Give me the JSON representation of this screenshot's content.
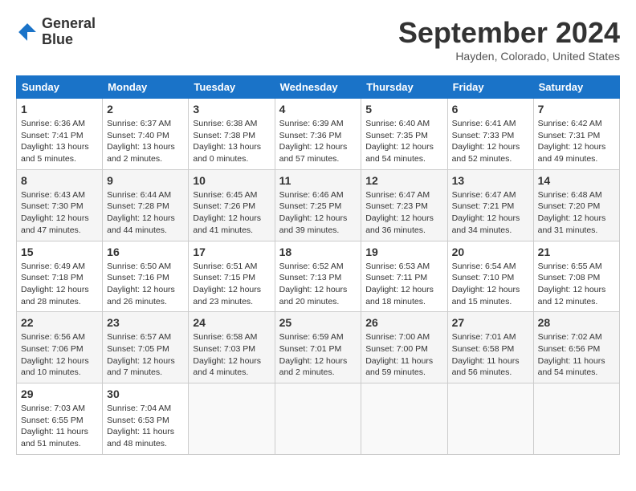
{
  "header": {
    "logo_line1": "General",
    "logo_line2": "Blue",
    "month": "September 2024",
    "location": "Hayden, Colorado, United States"
  },
  "days_of_week": [
    "Sunday",
    "Monday",
    "Tuesday",
    "Wednesday",
    "Thursday",
    "Friday",
    "Saturday"
  ],
  "weeks": [
    [
      {
        "num": "1",
        "info": "Sunrise: 6:36 AM\nSunset: 7:41 PM\nDaylight: 13 hours\nand 5 minutes."
      },
      {
        "num": "2",
        "info": "Sunrise: 6:37 AM\nSunset: 7:40 PM\nDaylight: 13 hours\nand 2 minutes."
      },
      {
        "num": "3",
        "info": "Sunrise: 6:38 AM\nSunset: 7:38 PM\nDaylight: 13 hours\nand 0 minutes."
      },
      {
        "num": "4",
        "info": "Sunrise: 6:39 AM\nSunset: 7:36 PM\nDaylight: 12 hours\nand 57 minutes."
      },
      {
        "num": "5",
        "info": "Sunrise: 6:40 AM\nSunset: 7:35 PM\nDaylight: 12 hours\nand 54 minutes."
      },
      {
        "num": "6",
        "info": "Sunrise: 6:41 AM\nSunset: 7:33 PM\nDaylight: 12 hours\nand 52 minutes."
      },
      {
        "num": "7",
        "info": "Sunrise: 6:42 AM\nSunset: 7:31 PM\nDaylight: 12 hours\nand 49 minutes."
      }
    ],
    [
      {
        "num": "8",
        "info": "Sunrise: 6:43 AM\nSunset: 7:30 PM\nDaylight: 12 hours\nand 47 minutes."
      },
      {
        "num": "9",
        "info": "Sunrise: 6:44 AM\nSunset: 7:28 PM\nDaylight: 12 hours\nand 44 minutes."
      },
      {
        "num": "10",
        "info": "Sunrise: 6:45 AM\nSunset: 7:26 PM\nDaylight: 12 hours\nand 41 minutes."
      },
      {
        "num": "11",
        "info": "Sunrise: 6:46 AM\nSunset: 7:25 PM\nDaylight: 12 hours\nand 39 minutes."
      },
      {
        "num": "12",
        "info": "Sunrise: 6:47 AM\nSunset: 7:23 PM\nDaylight: 12 hours\nand 36 minutes."
      },
      {
        "num": "13",
        "info": "Sunrise: 6:47 AM\nSunset: 7:21 PM\nDaylight: 12 hours\nand 34 minutes."
      },
      {
        "num": "14",
        "info": "Sunrise: 6:48 AM\nSunset: 7:20 PM\nDaylight: 12 hours\nand 31 minutes."
      }
    ],
    [
      {
        "num": "15",
        "info": "Sunrise: 6:49 AM\nSunset: 7:18 PM\nDaylight: 12 hours\nand 28 minutes."
      },
      {
        "num": "16",
        "info": "Sunrise: 6:50 AM\nSunset: 7:16 PM\nDaylight: 12 hours\nand 26 minutes."
      },
      {
        "num": "17",
        "info": "Sunrise: 6:51 AM\nSunset: 7:15 PM\nDaylight: 12 hours\nand 23 minutes."
      },
      {
        "num": "18",
        "info": "Sunrise: 6:52 AM\nSunset: 7:13 PM\nDaylight: 12 hours\nand 20 minutes."
      },
      {
        "num": "19",
        "info": "Sunrise: 6:53 AM\nSunset: 7:11 PM\nDaylight: 12 hours\nand 18 minutes."
      },
      {
        "num": "20",
        "info": "Sunrise: 6:54 AM\nSunset: 7:10 PM\nDaylight: 12 hours\nand 15 minutes."
      },
      {
        "num": "21",
        "info": "Sunrise: 6:55 AM\nSunset: 7:08 PM\nDaylight: 12 hours\nand 12 minutes."
      }
    ],
    [
      {
        "num": "22",
        "info": "Sunrise: 6:56 AM\nSunset: 7:06 PM\nDaylight: 12 hours\nand 10 minutes."
      },
      {
        "num": "23",
        "info": "Sunrise: 6:57 AM\nSunset: 7:05 PM\nDaylight: 12 hours\nand 7 minutes."
      },
      {
        "num": "24",
        "info": "Sunrise: 6:58 AM\nSunset: 7:03 PM\nDaylight: 12 hours\nand 4 minutes."
      },
      {
        "num": "25",
        "info": "Sunrise: 6:59 AM\nSunset: 7:01 PM\nDaylight: 12 hours\nand 2 minutes."
      },
      {
        "num": "26",
        "info": "Sunrise: 7:00 AM\nSunset: 7:00 PM\nDaylight: 11 hours\nand 59 minutes."
      },
      {
        "num": "27",
        "info": "Sunrise: 7:01 AM\nSunset: 6:58 PM\nDaylight: 11 hours\nand 56 minutes."
      },
      {
        "num": "28",
        "info": "Sunrise: 7:02 AM\nSunset: 6:56 PM\nDaylight: 11 hours\nand 54 minutes."
      }
    ],
    [
      {
        "num": "29",
        "info": "Sunrise: 7:03 AM\nSunset: 6:55 PM\nDaylight: 11 hours\nand 51 minutes."
      },
      {
        "num": "30",
        "info": "Sunrise: 7:04 AM\nSunset: 6:53 PM\nDaylight: 11 hours\nand 48 minutes."
      },
      {
        "num": "",
        "info": ""
      },
      {
        "num": "",
        "info": ""
      },
      {
        "num": "",
        "info": ""
      },
      {
        "num": "",
        "info": ""
      },
      {
        "num": "",
        "info": ""
      }
    ]
  ]
}
